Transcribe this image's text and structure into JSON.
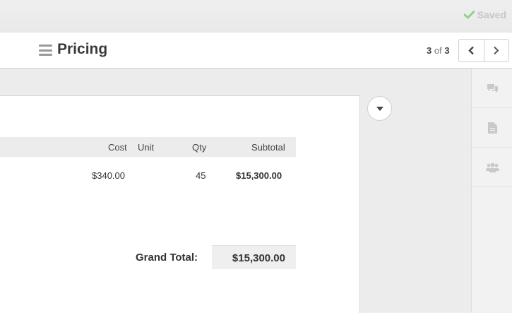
{
  "status": {
    "saved_label": "Saved",
    "icon": "check-icon"
  },
  "header": {
    "title": "Pricing",
    "page_current": "3",
    "page_of": "of",
    "page_total": "3",
    "prev_icon": "chevron-left-icon",
    "next_icon": "chevron-right-icon"
  },
  "table": {
    "columns": [
      "Cost",
      "Unit",
      "Qty",
      "Subtotal"
    ],
    "rows": [
      {
        "cost": "$340.00",
        "unit": "",
        "qty": "45",
        "subtotal": "$15,300.00"
      }
    ],
    "grand_total_label": "Grand Total:",
    "grand_total_value": "$15,300.00"
  },
  "rail": {
    "items": [
      {
        "icon": "comments-icon"
      },
      {
        "icon": "document-icon"
      },
      {
        "icon": "users-icon"
      }
    ]
  },
  "colors": {
    "saved_check": "#8fd28f",
    "icon_gray": "#c9c9c9"
  }
}
